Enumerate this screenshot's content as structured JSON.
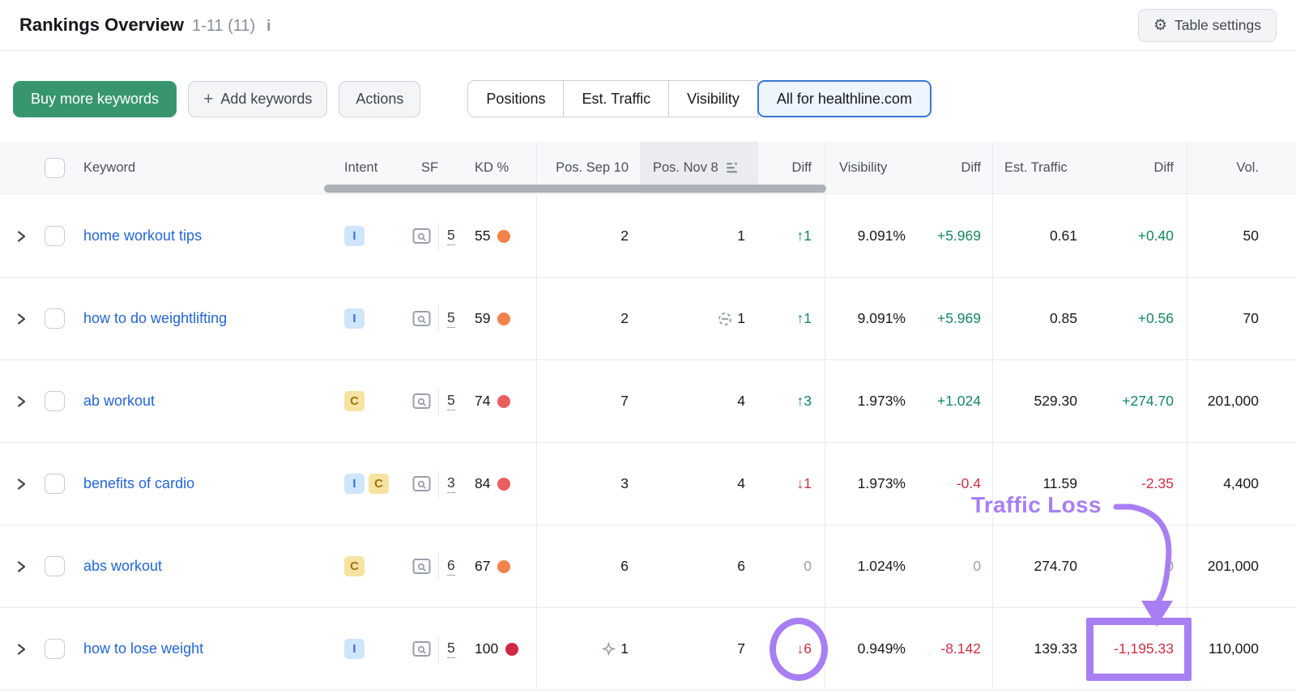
{
  "header": {
    "title": "Rankings Overview",
    "range": "1-11 (11)",
    "info_icon_glyph": "i"
  },
  "toolbar": {
    "buy_keywords": "Buy more keywords",
    "add_keywords": "Add keywords",
    "actions": "Actions",
    "plus_icon_glyph": "+",
    "table_settings": "Table settings",
    "gear_icon_glyph": "⚙",
    "view_tabs": [
      {
        "label": "Positions",
        "selected": false
      },
      {
        "label": "Est. Traffic",
        "selected": false
      },
      {
        "label": "Visibility",
        "selected": false
      },
      {
        "label": "All for healthline.com",
        "selected": true
      }
    ]
  },
  "table": {
    "headers": {
      "keyword": "Keyword",
      "intent": "Intent",
      "sf": "SF",
      "kd": "KD %",
      "pos_sep": "Pos. Sep 10",
      "pos_nov": "Pos. Nov 8",
      "pos_diff": "Diff",
      "visibility": "Visibility",
      "vis_diff": "Diff",
      "est_traffic": "Est. Traffic",
      "traffic_diff": "Diff",
      "volume": "Vol."
    },
    "sorted_column": "Pos. Nov 8",
    "rows": [
      {
        "keyword": "home workout tips",
        "intents": [
          "I"
        ],
        "sf": "5",
        "kd": "55",
        "kd_color": "#f0824a",
        "pos_sep": "2",
        "pos_sep_icon": null,
        "pos_nov": "1",
        "pos_nov_icon": null,
        "pos_diff": {
          "text": "↑1",
          "dir": "up"
        },
        "visibility": "9.091%",
        "vis_diff": {
          "text": "+5.969",
          "dir": "up"
        },
        "est_traffic": "0.61",
        "traffic_diff": {
          "text": "+0.40",
          "dir": "up"
        },
        "volume": "50"
      },
      {
        "keyword": "how to do weightlifting",
        "intents": [
          "I"
        ],
        "sf": "5",
        "kd": "59",
        "kd_color": "#f0824a",
        "pos_sep": "2",
        "pos_sep_icon": null,
        "pos_nov": "1",
        "pos_nov_icon": "link",
        "pos_diff": {
          "text": "↑1",
          "dir": "up"
        },
        "visibility": "9.091%",
        "vis_diff": {
          "text": "+5.969",
          "dir": "up"
        },
        "est_traffic": "0.85",
        "traffic_diff": {
          "text": "+0.56",
          "dir": "up"
        },
        "volume": "70"
      },
      {
        "keyword": "ab workout",
        "intents": [
          "C"
        ],
        "sf": "5",
        "kd": "74",
        "kd_color": "#e95f60",
        "pos_sep": "7",
        "pos_sep_icon": null,
        "pos_nov": "4",
        "pos_nov_icon": null,
        "pos_diff": {
          "text": "↑3",
          "dir": "up"
        },
        "visibility": "1.973%",
        "vis_diff": {
          "text": "+1.024",
          "dir": "up"
        },
        "est_traffic": "529.30",
        "traffic_diff": {
          "text": "+274.70",
          "dir": "up"
        },
        "volume": "201,000"
      },
      {
        "keyword": "benefits of cardio",
        "intents": [
          "I",
          "C"
        ],
        "sf": "3",
        "kd": "84",
        "kd_color": "#e95f60",
        "pos_sep": "3",
        "pos_sep_icon": null,
        "pos_nov": "4",
        "pos_nov_icon": null,
        "pos_diff": {
          "text": "↓1",
          "dir": "down"
        },
        "visibility": "1.973%",
        "vis_diff": {
          "text": "-0.4",
          "dir": "down"
        },
        "est_traffic": "11.59",
        "traffic_diff": {
          "text": "-2.35",
          "dir": "down"
        },
        "volume": "4,400"
      },
      {
        "keyword": "abs workout",
        "intents": [
          "C"
        ],
        "sf": "6",
        "kd": "67",
        "kd_color": "#f0824a",
        "pos_sep": "6",
        "pos_sep_icon": null,
        "pos_nov": "6",
        "pos_nov_icon": null,
        "pos_diff": {
          "text": "0",
          "dir": "zero"
        },
        "visibility": "1.024%",
        "vis_diff": {
          "text": "0",
          "dir": "zero"
        },
        "est_traffic": "274.70",
        "traffic_diff": {
          "text": "0",
          "dir": "zero"
        },
        "volume": "201,000"
      },
      {
        "keyword": "how to lose weight",
        "intents": [
          "I"
        ],
        "sf": "5",
        "kd": "100",
        "kd_color": "#d32743",
        "pos_sep": "1",
        "pos_sep_icon": "sparkle",
        "pos_nov": "7",
        "pos_nov_icon": null,
        "pos_diff": {
          "text": "↓6",
          "dir": "down",
          "circled": true
        },
        "visibility": "0.949%",
        "vis_diff": {
          "text": "-8.142",
          "dir": "down"
        },
        "est_traffic": "139.33",
        "traffic_diff": {
          "text": "-1,195.33",
          "dir": "down",
          "boxed": true
        },
        "volume": "110,000"
      }
    ]
  },
  "annotation": {
    "traffic_loss_label": "Traffic Loss"
  },
  "colors": {
    "accent_green": "#38966f",
    "link_blue": "#2465d4",
    "positive": "#15865e",
    "negative": "#cd2f44",
    "neutral_zero": "#9aa1ab",
    "annotation_purple": "#a87ef3",
    "selected_tab_border": "#3a76d4",
    "kd_orange": "#f0824a",
    "kd_red": "#e95f60",
    "kd_darkred": "#d32743"
  }
}
